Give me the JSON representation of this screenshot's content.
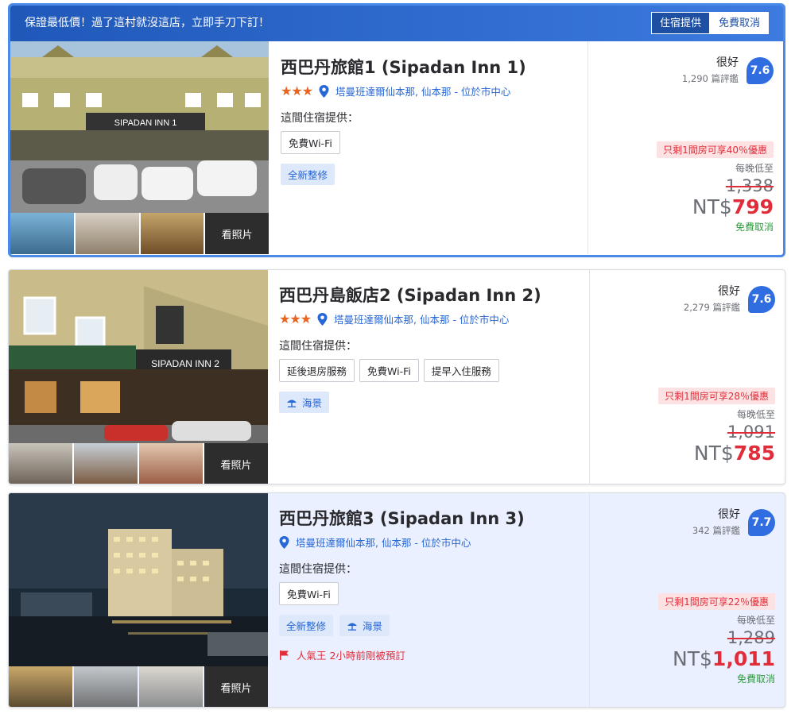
{
  "cards": [
    {
      "banner": {
        "text": "保證最低價！過了這村就沒這店，立即手刀下訂！",
        "provider_tag": "住宿提供",
        "free_cancel_tag": "免費取消"
      },
      "name": "西巴丹旅館1 (Sipadan Inn 1)",
      "stars": "★★★",
      "location": "塔曼班達爾仙本那, 仙本那 - 位於市中心",
      "offer_title": "這間住宿提供：",
      "amenities": [
        "免費Wi-Fi"
      ],
      "highlights": [
        "全新整修"
      ],
      "more_photos": "看照片",
      "rating_word": "很好",
      "reviews": "1,290 篇評鑑",
      "score": "7.6",
      "deal": "只剩1間房可享40％優惠",
      "per_night": "每晚低至",
      "old_price": "1,338",
      "currency": "NT$",
      "price": "799",
      "free_cancel": "免費取消"
    },
    {
      "name": "西巴丹島飯店2 (Sipadan Inn 2)",
      "stars": "★★★",
      "location": "塔曼班達爾仙本那, 仙本那 - 位於市中心",
      "offer_title": "這間住宿提供：",
      "amenities": [
        "延後退房服務",
        "免費Wi-Fi",
        "提早入住服務"
      ],
      "highlights": [
        "海景"
      ],
      "more_photos": "看照片",
      "rating_word": "很好",
      "reviews": "2,279 篇評鑑",
      "score": "7.6",
      "deal": "只剩1間房可享28％優惠",
      "per_night": "每晚低至",
      "old_price": "1,091",
      "currency": "NT$",
      "price": "785"
    },
    {
      "name": "西巴丹旅館3 (Sipadan Inn 3)",
      "location": "塔曼班達爾仙本那, 仙本那 - 位於市中心",
      "offer_title": "這間住宿提供：",
      "amenities": [
        "免費Wi-Fi"
      ],
      "highlights": [
        "全新整修",
        "海景"
      ],
      "popular": "人氣王 2小時前剛被預訂",
      "more_photos": "看照片",
      "rating_word": "很好",
      "reviews": "342 篇評鑑",
      "score": "7.7",
      "deal": "只剩1間房可享22％優惠",
      "per_night": "每晚低至",
      "old_price": "1,289",
      "currency": "NT$",
      "price": "1,011",
      "free_cancel": "免費取消"
    }
  ],
  "colors": {
    "accent": "#2f6de0",
    "link": "#2867d6",
    "price": "#e12d39",
    "stars": "#e8641f",
    "free_cancel": "#2c9c3e",
    "selected_border": "#4a8ae8"
  },
  "icons": [
    "location-pin-icon",
    "beach-umbrella-icon",
    "flag-icon",
    "star-icon"
  ]
}
